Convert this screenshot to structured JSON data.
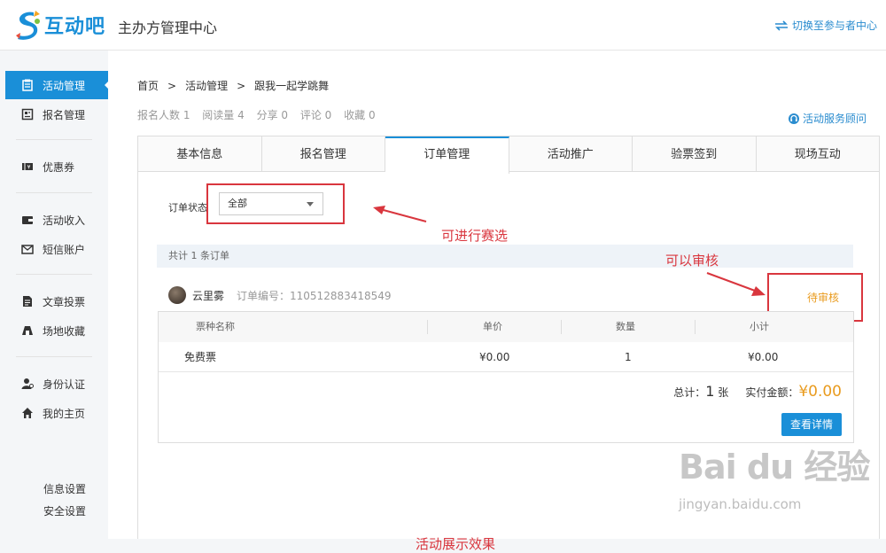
{
  "header": {
    "logo_text": "互动吧",
    "app_title": "主办方管理中心",
    "switch_label": "切换至参与者中心"
  },
  "sidebar": {
    "items": [
      {
        "label": "活动管理",
        "icon": "clipboard-icon",
        "active": true
      },
      {
        "label": "报名管理",
        "icon": "form-icon"
      },
      {
        "label": "优惠券",
        "icon": "coupon-icon"
      },
      {
        "label": "活动收入",
        "icon": "wallet-icon"
      },
      {
        "label": "短信账户",
        "icon": "envelope-icon"
      },
      {
        "label": "文章投票",
        "icon": "document-icon"
      },
      {
        "label": "场地收藏",
        "icon": "venue-icon"
      },
      {
        "label": "身份认证",
        "icon": "user-verify-icon"
      },
      {
        "label": "我的主页",
        "icon": "home-icon"
      }
    ],
    "bottom_links": [
      "信息设置",
      "安全设置"
    ]
  },
  "breadcrumb": {
    "items": [
      "首页",
      "活动管理",
      "跟我一起学跳舞"
    ],
    "separator": ">"
  },
  "stats": {
    "items": [
      "报名人数 1",
      "阅读量 4",
      "分享 0",
      "评论 0",
      "收藏 0"
    ]
  },
  "consult_label": "活动服务顾问",
  "tabs": [
    "基本信息",
    "报名管理",
    "订单管理",
    "活动推广",
    "验票签到",
    "现场互动"
  ],
  "active_tab": "订单管理",
  "filter": {
    "label": "订单状态",
    "selected": "全部"
  },
  "order_count_text": "共计 1 条订单",
  "order": {
    "user_name": "云里雾",
    "order_no": "订单编号：110512883418549",
    "status": "待审核",
    "columns": [
      "票种名称",
      "单价",
      "数量",
      "小计"
    ],
    "rows": [
      {
        "name": "免费票",
        "price": "¥0.00",
        "qty": "1",
        "subtotal": "¥0.00"
      }
    ],
    "total_label": "总计：",
    "total_count": "1",
    "total_unit": "张",
    "paid_label": "实付金额：",
    "paid_amount": "¥0.00",
    "detail_button": "查看详情"
  },
  "annotations": {
    "filter_note": "可进行赛选",
    "review_note": "可以审核",
    "display_note": "活动展示效果"
  },
  "watermark": {
    "logo": "Bai du 经验",
    "url": "jingyan.baidu.com"
  },
  "colors": {
    "accent": "#1a8fd8",
    "pending": "#e99b1e",
    "annotation": "#d9363e"
  }
}
